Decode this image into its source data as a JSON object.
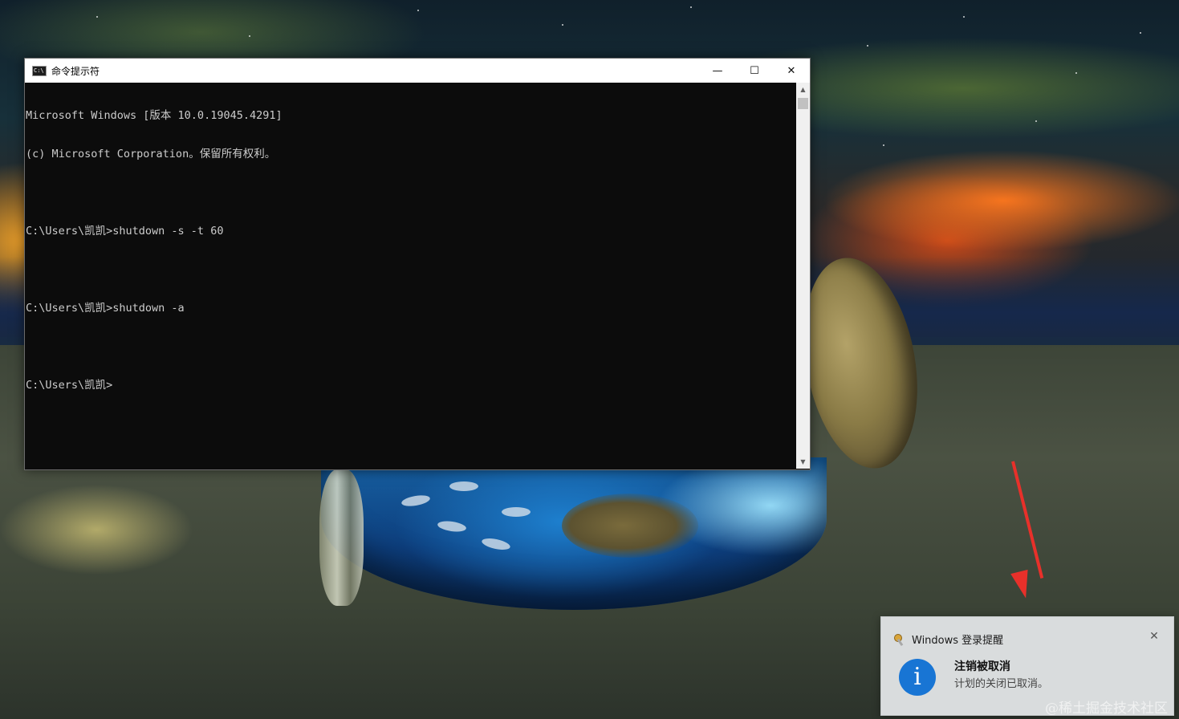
{
  "cmd_window": {
    "title": "命令提示符",
    "icon_label": "C:\\",
    "controls": {
      "minimize": "—",
      "maximize": "☐",
      "close": "✕"
    },
    "console_lines": [
      "Microsoft Windows [版本 10.0.19045.4291]",
      "(c) Microsoft Corporation。保留所有权利。",
      "",
      "C:\\Users\\凯凯>shutdown -s -t 60",
      "",
      "C:\\Users\\凯凯>shutdown -a",
      "",
      "C:\\Users\\凯凯>"
    ],
    "scroll_up": "▲",
    "scroll_down": "▼"
  },
  "toast": {
    "app_name": "Windows 登录提醒",
    "close": "✕",
    "icon_glyph": "i",
    "title": "注销被取消",
    "message": "计划的关闭已取消。"
  },
  "watermark": "@稀土掘金技术社区",
  "colors": {
    "console_bg": "#0c0c0c",
    "console_text": "#cccccc",
    "info_blue": "#1875d4",
    "arrow_red": "#e8302a"
  }
}
